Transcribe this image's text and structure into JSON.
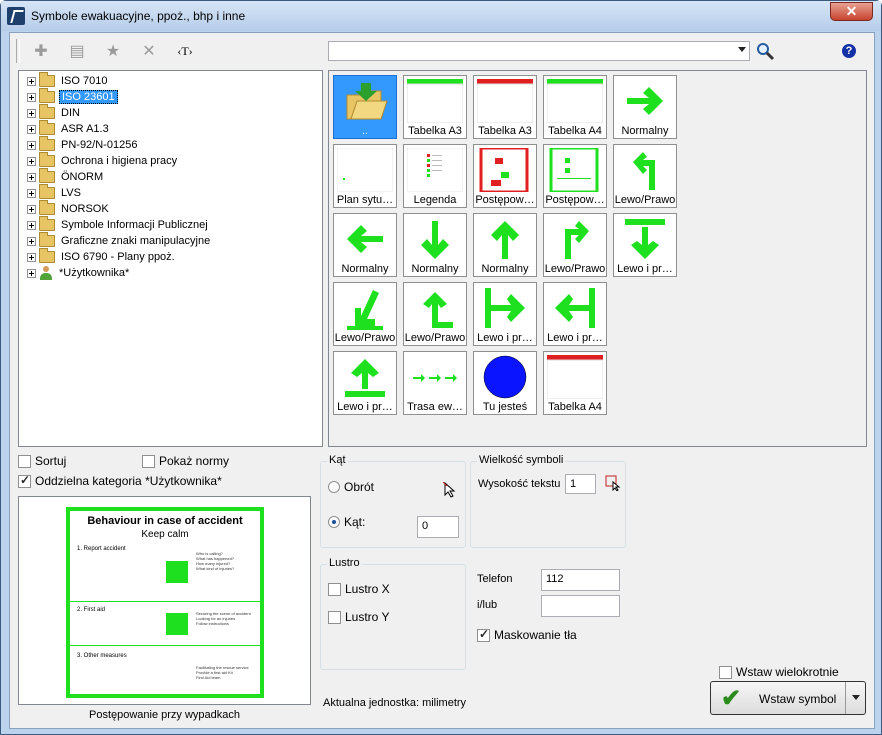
{
  "window": {
    "title": "Symbole ewakuacyjne, ppoż., bhp i inne",
    "close": "✕"
  },
  "toolbar": {
    "text_tool": "‹T›",
    "help": "?",
    "search_value": ""
  },
  "tree": [
    {
      "label": "ISO 7010",
      "selected": false
    },
    {
      "label": "ISO 23601",
      "selected": true
    },
    {
      "label": "DIN",
      "selected": false
    },
    {
      "label": "ASR A1.3",
      "selected": false
    },
    {
      "label": "PN-92/N-01256",
      "selected": false
    },
    {
      "label": "Ochrona i higiena pracy",
      "selected": false
    },
    {
      "label": "ÖNORM",
      "selected": false
    },
    {
      "label": "LVS",
      "selected": false
    },
    {
      "label": "NORSOK",
      "selected": false
    },
    {
      "label": "Symbole Informacji Publicznej",
      "selected": false
    },
    {
      "label": "Graficzne znaki manipulacyjne",
      "selected": false
    },
    {
      "label": "ISO 6790 - Plany ppoż.",
      "selected": false
    },
    {
      "label": "*Użytkownika*",
      "selected": false
    }
  ],
  "symbols": [
    {
      "caption": "..",
      "kind": "up-folder"
    },
    {
      "caption": "Plan sytu…",
      "kind": "doc-blank"
    },
    {
      "caption": "Normalny",
      "kind": "arrow-left"
    },
    {
      "caption": "Lewo/Prawo",
      "kind": "arrow-downleft"
    },
    {
      "caption": "Lewo i pr…",
      "kind": "arrow-up-bar"
    },
    {
      "caption": "Tabelka A3",
      "kind": "table-green"
    },
    {
      "caption": "Legenda",
      "kind": "legend"
    },
    {
      "caption": "Normalny",
      "kind": "arrow-down"
    },
    {
      "caption": "Lewo/Prawo",
      "kind": "arrow-upleft"
    },
    {
      "caption": "Trasa ew…",
      "kind": "arrows-route"
    },
    {
      "caption": "Tabelka A3",
      "kind": "table-red"
    },
    {
      "caption": "Postępow…",
      "kind": "doc-red"
    },
    {
      "caption": "Normalny",
      "kind": "arrow-up"
    },
    {
      "caption": "Lewo i pr…",
      "kind": "arrow-right-bar"
    },
    {
      "caption": "Tu jesteś",
      "kind": "blue-dot"
    },
    {
      "caption": "Tabelka A4",
      "kind": "table-green"
    },
    {
      "caption": "Postępow…",
      "kind": "doc-green"
    },
    {
      "caption": "Lewo/Prawo",
      "kind": "arrow-upright"
    },
    {
      "caption": "Lewo i pr…",
      "kind": "arrow-left-bar"
    },
    {
      "caption": "Tabelka A4",
      "kind": "table-red"
    },
    {
      "caption": "Normalny",
      "kind": "arrow-right"
    },
    {
      "caption": "Lewo/Prawo",
      "kind": "arrow-upleft2"
    },
    {
      "caption": "Lewo i pr…",
      "kind": "arrow-down-bar"
    }
  ],
  "options": {
    "sort": "Sortuj",
    "sort_checked": false,
    "show_norms": "Pokaż normy",
    "show_norms_checked": false,
    "separate_cat": "Oddzielna kategoria *Użytkownika*",
    "separate_cat_checked": true
  },
  "preview": {
    "caption": "Postępowanie przy wypadkach",
    "heading": "Behaviour in case of accident",
    "sub": "Keep calm",
    "s1": "1.  Report accident",
    "s2": "2.  First aid",
    "s3": "3.  Other measures",
    "s1_lines": "Who is calling?\nWhat has happened?\nHow many injured?\nWhat kind of injuries?",
    "s2_lines": "Securing the scene of accident\nLooking for an injuries\nFollow instructions",
    "s3_lines": "Facilitating the rescue service\nProvide a first aid Kit\nFirst Aid team"
  },
  "angle": {
    "legend": "Kąt",
    "rotation": "Obrót",
    "angle_label": "Kąt:",
    "angle_value": "0",
    "selected": "angle"
  },
  "size": {
    "legend": "Wielkość symboli",
    "text_height_label": "Wysokość tekstu",
    "text_height_value": "1"
  },
  "mirror": {
    "legend": "Lustro",
    "x": "Lustro X",
    "y": "Lustro Y",
    "x_checked": false,
    "y_checked": false
  },
  "phone": {
    "label": "Telefon",
    "value": "112",
    "or_label": "i/lub",
    "or_value": "",
    "mask": "Maskowanie tła",
    "mask_checked": true
  },
  "insert": {
    "multi": "Wstaw wielokrotnie",
    "multi_checked": false,
    "button": "Wstaw symbol"
  },
  "unit": "Aktualna jednostka: milimetry",
  "colors": {
    "green": "#1ee01e",
    "red": "#e02020",
    "blue": "#0a14ff",
    "select": "#3399ff"
  }
}
